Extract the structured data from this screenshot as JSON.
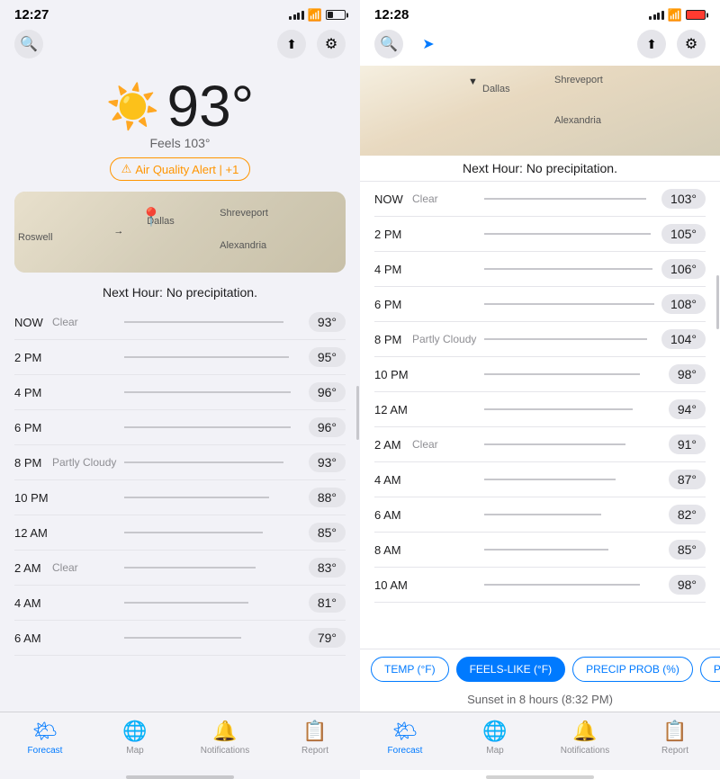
{
  "leftPhone": {
    "statusBar": {
      "time": "12:27",
      "location": true
    },
    "header": {
      "searchLabel": "🔍",
      "shareLabel": "⬆",
      "settingsLabel": "⚙"
    },
    "weather": {
      "temp": "93°",
      "feelsLike": "Feels 103°",
      "alert": "Air Quality Alert | +1",
      "sunIcon": "☀️"
    },
    "map": {
      "labels": [
        "Roswell",
        "Dallas",
        "Shreveport",
        "Alexandria"
      ],
      "precipText": "Next Hour: No precipitation."
    },
    "hourly": [
      {
        "time": "NOW",
        "condition": "Clear",
        "temp": "93°",
        "barWidth": "90%"
      },
      {
        "time": "2 PM",
        "condition": "",
        "temp": "95°",
        "barWidth": "93%"
      },
      {
        "time": "4 PM",
        "condition": "",
        "temp": "96°",
        "barWidth": "94%"
      },
      {
        "time": "6 PM",
        "condition": "",
        "temp": "96°",
        "barWidth": "94%"
      },
      {
        "time": "8 PM",
        "condition": "Partly Cloudy",
        "temp": "93°",
        "barWidth": "90%"
      },
      {
        "time": "10 PM",
        "condition": "",
        "temp": "88°",
        "barWidth": "82%"
      },
      {
        "time": "12 AM",
        "condition": "",
        "temp": "85°",
        "barWidth": "78%"
      },
      {
        "time": "2 AM",
        "condition": "Clear",
        "temp": "83°",
        "barWidth": "74%"
      },
      {
        "time": "4 AM",
        "condition": "",
        "temp": "81°",
        "barWidth": "70%"
      },
      {
        "time": "6 AM",
        "condition": "",
        "temp": "79°",
        "barWidth": "66%"
      }
    ],
    "nav": [
      {
        "id": "forecast",
        "icon": "🌤",
        "label": "Forecast",
        "active": true
      },
      {
        "id": "map",
        "icon": "🌐",
        "label": "Map",
        "active": false
      },
      {
        "id": "notifications",
        "icon": "🔔",
        "label": "Notifications",
        "active": false
      },
      {
        "id": "report",
        "icon": "📋",
        "label": "Report",
        "active": false
      }
    ]
  },
  "rightPhone": {
    "statusBar": {
      "time": "12:28",
      "location": true,
      "batteryLow": true
    },
    "header": {
      "searchLabel": "🔍",
      "locationLabel": "➤",
      "shareLabel": "⬆",
      "settingsLabel": "⚙"
    },
    "map": {
      "labels": [
        "Dallas",
        "Shreveport",
        "Alexandria"
      ],
      "precipText": "Next Hour: No precipitation."
    },
    "hourly": [
      {
        "time": "NOW",
        "condition": "Clear",
        "temp": "103°",
        "barWidth": "95%"
      },
      {
        "time": "2 PM",
        "condition": "",
        "temp": "105°",
        "barWidth": "98%"
      },
      {
        "time": "4 PM",
        "condition": "",
        "temp": "106°",
        "barWidth": "99%"
      },
      {
        "time": "6 PM",
        "condition": "",
        "temp": "108°",
        "barWidth": "100%"
      },
      {
        "time": "8 PM",
        "condition": "Partly Cloudy",
        "temp": "104°",
        "barWidth": "96%"
      },
      {
        "time": "10 PM",
        "condition": "",
        "temp": "98°",
        "barWidth": "88%"
      },
      {
        "time": "12 AM",
        "condition": "",
        "temp": "94°",
        "barWidth": "84%"
      },
      {
        "time": "2 AM",
        "condition": "Clear",
        "temp": "91°",
        "barWidth": "80%"
      },
      {
        "time": "4 AM",
        "condition": "",
        "temp": "87°",
        "barWidth": "74%"
      },
      {
        "time": "6 AM",
        "condition": "",
        "temp": "82°",
        "barWidth": "66%"
      },
      {
        "time": "8 AM",
        "condition": "",
        "temp": "85°",
        "barWidth": "70%"
      },
      {
        "time": "10 AM",
        "condition": "",
        "temp": "98°",
        "barWidth": "88%"
      }
    ],
    "filters": [
      {
        "label": "TEMP (°F)",
        "active": false
      },
      {
        "label": "FEELS-LIKE (°F)",
        "active": true
      },
      {
        "label": "PRECIP PROB (%)",
        "active": false
      },
      {
        "label": "PRECI...",
        "active": false
      }
    ],
    "sunsetText": "Sunset in 8 hours (8:32 PM)",
    "nav": [
      {
        "id": "forecast",
        "icon": "🌤",
        "label": "Forecast",
        "active": true
      },
      {
        "id": "map",
        "icon": "🌐",
        "label": "Map",
        "active": false
      },
      {
        "id": "notifications",
        "icon": "🔔",
        "label": "Notifications",
        "active": false
      },
      {
        "id": "report",
        "icon": "📋",
        "label": "Report",
        "active": false
      }
    ]
  }
}
